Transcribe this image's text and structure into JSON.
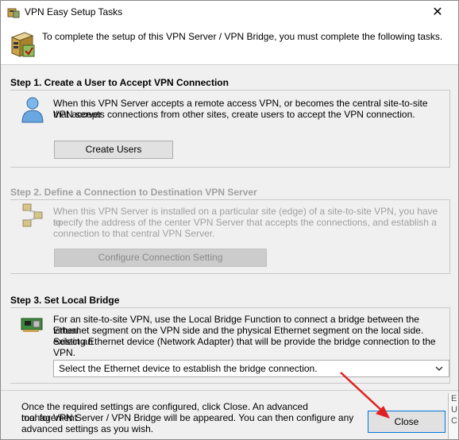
{
  "window": {
    "title": "VPN Easy Setup Tasks",
    "close_glyph": "✕"
  },
  "header": {
    "text": "To complete the setup of this VPN Server / VPN Bridge, you must complete the following tasks."
  },
  "step1": {
    "title": "Step 1. Create a User to Accept VPN Connection",
    "desc_line1": "When this VPN Server accepts a remote access VPN, or becomes the central site-to-site VPN server",
    "desc_line2": "that accepts connections from other sites, create users to accept the VPN connection.",
    "button_label": "Create Users",
    "icon": "user-icon"
  },
  "step2": {
    "title": "Step 2. Define a Connection to Destination VPN Server",
    "desc_line1": "When this VPN Server is installed on a particular site (edge) of a site-to-site VPN, you have to",
    "desc_line2": "specify the address of the center VPN Server that accepts the connections, and establish a",
    "desc_line3": "connection to that central VPN Server.",
    "button_label": "Configure Connection Setting",
    "icon": "network-icon",
    "enabled": false
  },
  "step3": {
    "title": "Step 3. Set Local Bridge",
    "desc_line1": "For an site-to-site VPN, use the Local Bridge Function to connect a bridge between the virtual",
    "desc_line2": "Ethernet segment on the VPN side and the physical Ethernet segment on the local side. Select an",
    "desc_line3": "existing Ethernet device (Network Adapter) that will be provide the bridge connection to the VPN.",
    "select_value": "Select the Ethernet device to establish the bridge connection.",
    "icon": "network-card-icon"
  },
  "footer": {
    "line1": "Once the required settings are configured, click Close. An advanced management",
    "line2": "tool for VPN Server / VPN Bridge will be appeared. You can then configure any",
    "line3": "advanced settings as you wish.",
    "close_label": "Close"
  },
  "background_window": {
    "line1": "E",
    "line2": "U",
    "line3": "C"
  },
  "colors": {
    "annotation_arrow": "#e02020",
    "focus_border": "#0078d7",
    "disabled_text": "#a0a0a0"
  }
}
